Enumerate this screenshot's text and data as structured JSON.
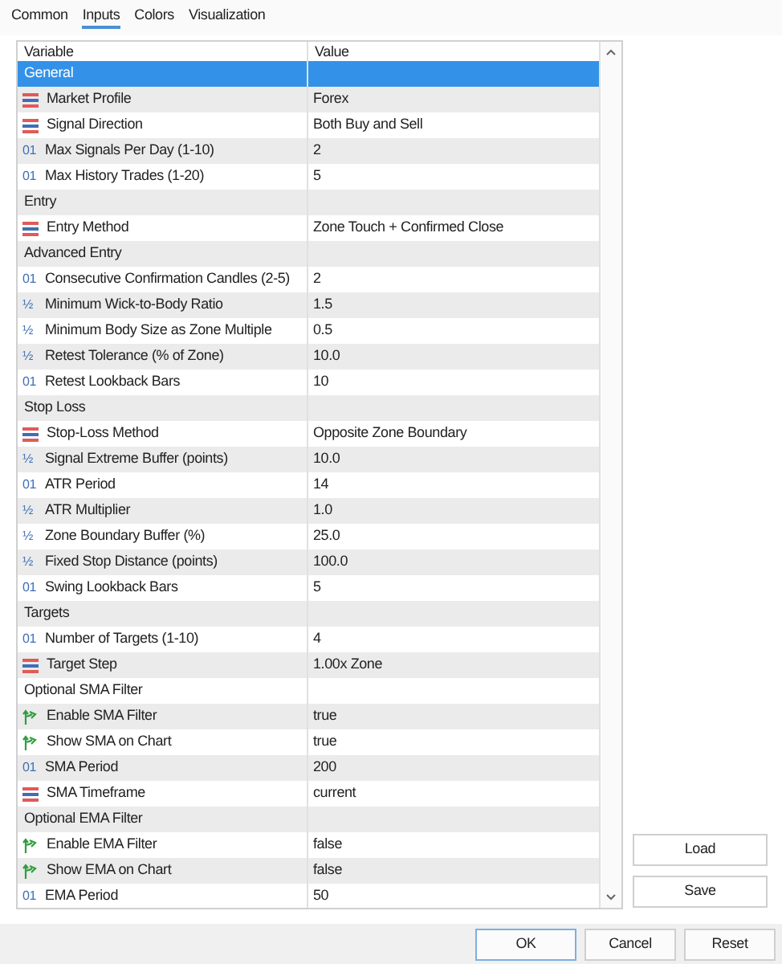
{
  "tabs": [
    {
      "label": "Common",
      "selected": false
    },
    {
      "label": "Inputs",
      "selected": true
    },
    {
      "label": "Colors",
      "selected": false
    },
    {
      "label": "Visualization",
      "selected": false
    }
  ],
  "table": {
    "columns": [
      "Variable",
      "Value"
    ],
    "rows": [
      {
        "kind": "group",
        "variable": "General",
        "value": "",
        "selected": true
      },
      {
        "kind": "enum",
        "variable": "Market Profile",
        "value": "Forex",
        "selected": false
      },
      {
        "kind": "enum",
        "variable": "Signal Direction",
        "value": "Both Buy and Sell",
        "selected": false
      },
      {
        "kind": "int",
        "icon": "01",
        "variable": "Max Signals Per Day (1-10)",
        "value": "2",
        "selected": false
      },
      {
        "kind": "int",
        "icon": "01",
        "variable": "Max History Trades (1-20)",
        "value": "5",
        "selected": false
      },
      {
        "kind": "group",
        "variable": "Entry",
        "value": "",
        "selected": false
      },
      {
        "kind": "enum",
        "variable": "Entry Method",
        "value": "Zone Touch + Confirmed Close",
        "selected": false
      },
      {
        "kind": "group",
        "variable": "Advanced Entry",
        "value": "",
        "selected": false
      },
      {
        "kind": "int",
        "icon": "01",
        "variable": "Consecutive Confirmation Candles (2-5)",
        "value": "2",
        "selected": false
      },
      {
        "kind": "double",
        "icon": "½",
        "variable": "Minimum Wick-to-Body Ratio",
        "value": "1.5",
        "selected": false
      },
      {
        "kind": "double",
        "icon": "½",
        "variable": "Minimum Body Size as Zone Multiple",
        "value": "0.5",
        "selected": false
      },
      {
        "kind": "double",
        "icon": "½",
        "variable": "Retest Tolerance (% of Zone)",
        "value": "10.0",
        "selected": false
      },
      {
        "kind": "int",
        "icon": "01",
        "variable": "Retest Lookback Bars",
        "value": "10",
        "selected": false
      },
      {
        "kind": "group",
        "variable": "Stop Loss",
        "value": "",
        "selected": false
      },
      {
        "kind": "enum",
        "variable": "Stop-Loss Method",
        "value": "Opposite Zone Boundary",
        "selected": false
      },
      {
        "kind": "double",
        "icon": "½",
        "variable": "Signal Extreme Buffer (points)",
        "value": "10.0",
        "selected": false
      },
      {
        "kind": "int",
        "icon": "01",
        "variable": "ATR Period",
        "value": "14",
        "selected": false
      },
      {
        "kind": "double",
        "icon": "½",
        "variable": "ATR Multiplier",
        "value": "1.0",
        "selected": false
      },
      {
        "kind": "double",
        "icon": "½",
        "variable": "Zone Boundary Buffer (%)",
        "value": "25.0",
        "selected": false
      },
      {
        "kind": "double",
        "icon": "½",
        "variable": "Fixed Stop Distance (points)",
        "value": "100.0",
        "selected": false
      },
      {
        "kind": "int",
        "icon": "01",
        "variable": "Swing Lookback Bars",
        "value": "5",
        "selected": false
      },
      {
        "kind": "group",
        "variable": "Targets",
        "value": "",
        "selected": false
      },
      {
        "kind": "int",
        "icon": "01",
        "variable": "Number of Targets (1-10)",
        "value": "4",
        "selected": false
      },
      {
        "kind": "enum",
        "variable": "Target Step",
        "value": "1.00x Zone",
        "selected": false
      },
      {
        "kind": "group",
        "variable": "Optional SMA Filter",
        "value": "",
        "selected": false
      },
      {
        "kind": "bool",
        "variable": "Enable SMA Filter",
        "value": "true",
        "selected": false
      },
      {
        "kind": "bool",
        "variable": "Show SMA on Chart",
        "value": "true",
        "selected": false
      },
      {
        "kind": "int",
        "icon": "01",
        "variable": "SMA Period",
        "value": "200",
        "selected": false
      },
      {
        "kind": "enum",
        "variable": "SMA Timeframe",
        "value": "current",
        "selected": false
      },
      {
        "kind": "group",
        "variable": "Optional EMA Filter",
        "value": "",
        "selected": false
      },
      {
        "kind": "bool",
        "variable": "Enable EMA Filter",
        "value": "false",
        "selected": false
      },
      {
        "kind": "bool",
        "variable": "Show EMA on Chart",
        "value": "false",
        "selected": false
      },
      {
        "kind": "int",
        "icon": "01",
        "variable": "EMA Period",
        "value": "50",
        "selected": false
      }
    ]
  },
  "side_buttons": [
    "Load",
    "Save"
  ],
  "buttons": [
    "OK",
    "Cancel",
    "Reset"
  ]
}
